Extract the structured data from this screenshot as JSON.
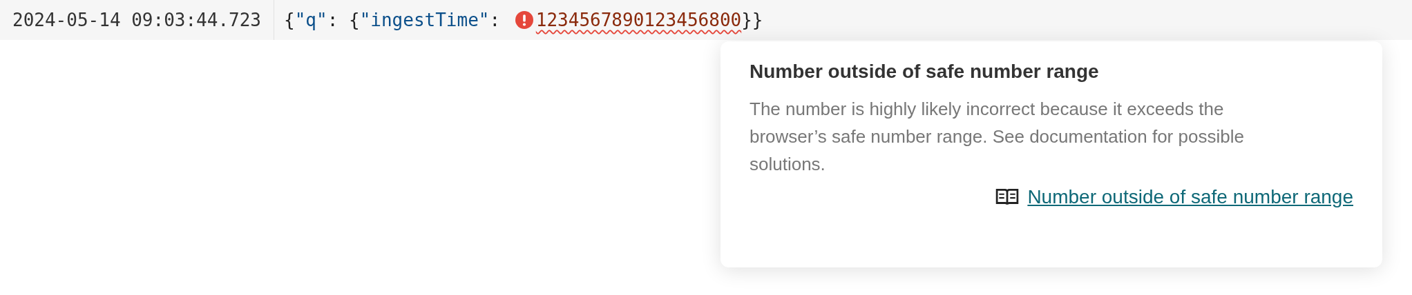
{
  "log_row": {
    "timestamp": "2024-05-14 09:03:44.723",
    "tokens": [
      {
        "kind": "punct",
        "text": "{"
      },
      {
        "kind": "key",
        "text": "\"q\""
      },
      {
        "kind": "punct",
        "text": ": {"
      },
      {
        "kind": "key",
        "text": "\"ingestTime\""
      },
      {
        "kind": "punct",
        "text": ": "
      },
      {
        "kind": "error_number",
        "text": "1234567890123456800"
      },
      {
        "kind": "punct",
        "text": "}}"
      }
    ]
  },
  "tooltip": {
    "title": "Number outside of safe number range",
    "body": "The number is highly likely incorrect because it exceeds the browser’s safe number range. See documentation for possible solutions.",
    "link": "Number outside of safe number range"
  }
}
